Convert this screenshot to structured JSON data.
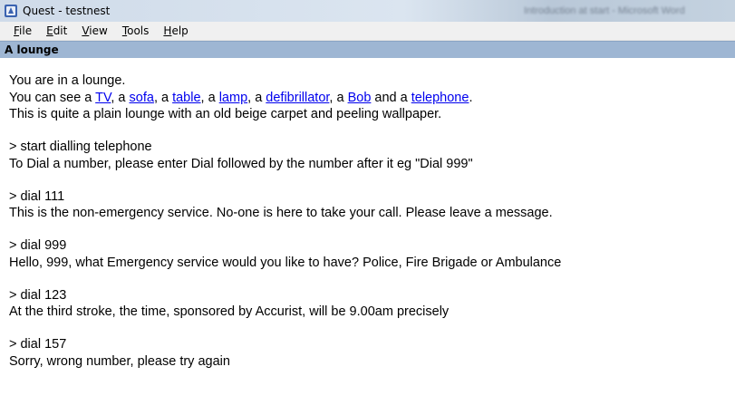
{
  "window": {
    "title": "Quest - testnest",
    "background_window_title": "Introduction at start - Microsoft Word"
  },
  "menu": [
    {
      "label": "File",
      "accel": "F",
      "rest": "ile"
    },
    {
      "label": "Edit",
      "accel": "E",
      "rest": "dit"
    },
    {
      "label": "View",
      "accel": "V",
      "rest": "iew"
    },
    {
      "label": "Tools",
      "accel": "T",
      "rest": "ools"
    },
    {
      "label": "Help",
      "accel": "H",
      "rest": "elp"
    }
  ],
  "location": "A lounge",
  "transcript": {
    "intro": {
      "line1": "You are in a lounge.",
      "see_prefix": "You can see a ",
      "objects": [
        "TV",
        "sofa",
        "table",
        "lamp",
        "defibrillator",
        "Bob",
        "telephone"
      ],
      "sep_comma": ", a ",
      "sep_and": " and a ",
      "see_suffix": ".",
      "line3": "This is quite a plain lounge with an old beige carpet and peeling wallpaper."
    },
    "exchanges": [
      {
        "command": "> start dialling telephone",
        "response": "To Dial a number, please enter Dial followed by the number after it eg \"Dial 999\""
      },
      {
        "command": "> dial 111",
        "response": "This is the non-emergency service. No-one is here to take your call. Please leave a message."
      },
      {
        "command": "> dial 999",
        "response": "Hello, 999, what Emergency service would you like to have? Police, Fire Brigade or Ambulance"
      },
      {
        "command": "> dial 123",
        "response": "At the third stroke, the time, sponsored by Accurist, will be 9.00am precisely"
      },
      {
        "command": "> dial 157",
        "response": "Sorry, wrong number, please try again"
      }
    ]
  },
  "colors": {
    "link": "#0000ee",
    "location_bar": "#9eb6d3"
  },
  "icons": {
    "app": "quest-app-icon"
  }
}
